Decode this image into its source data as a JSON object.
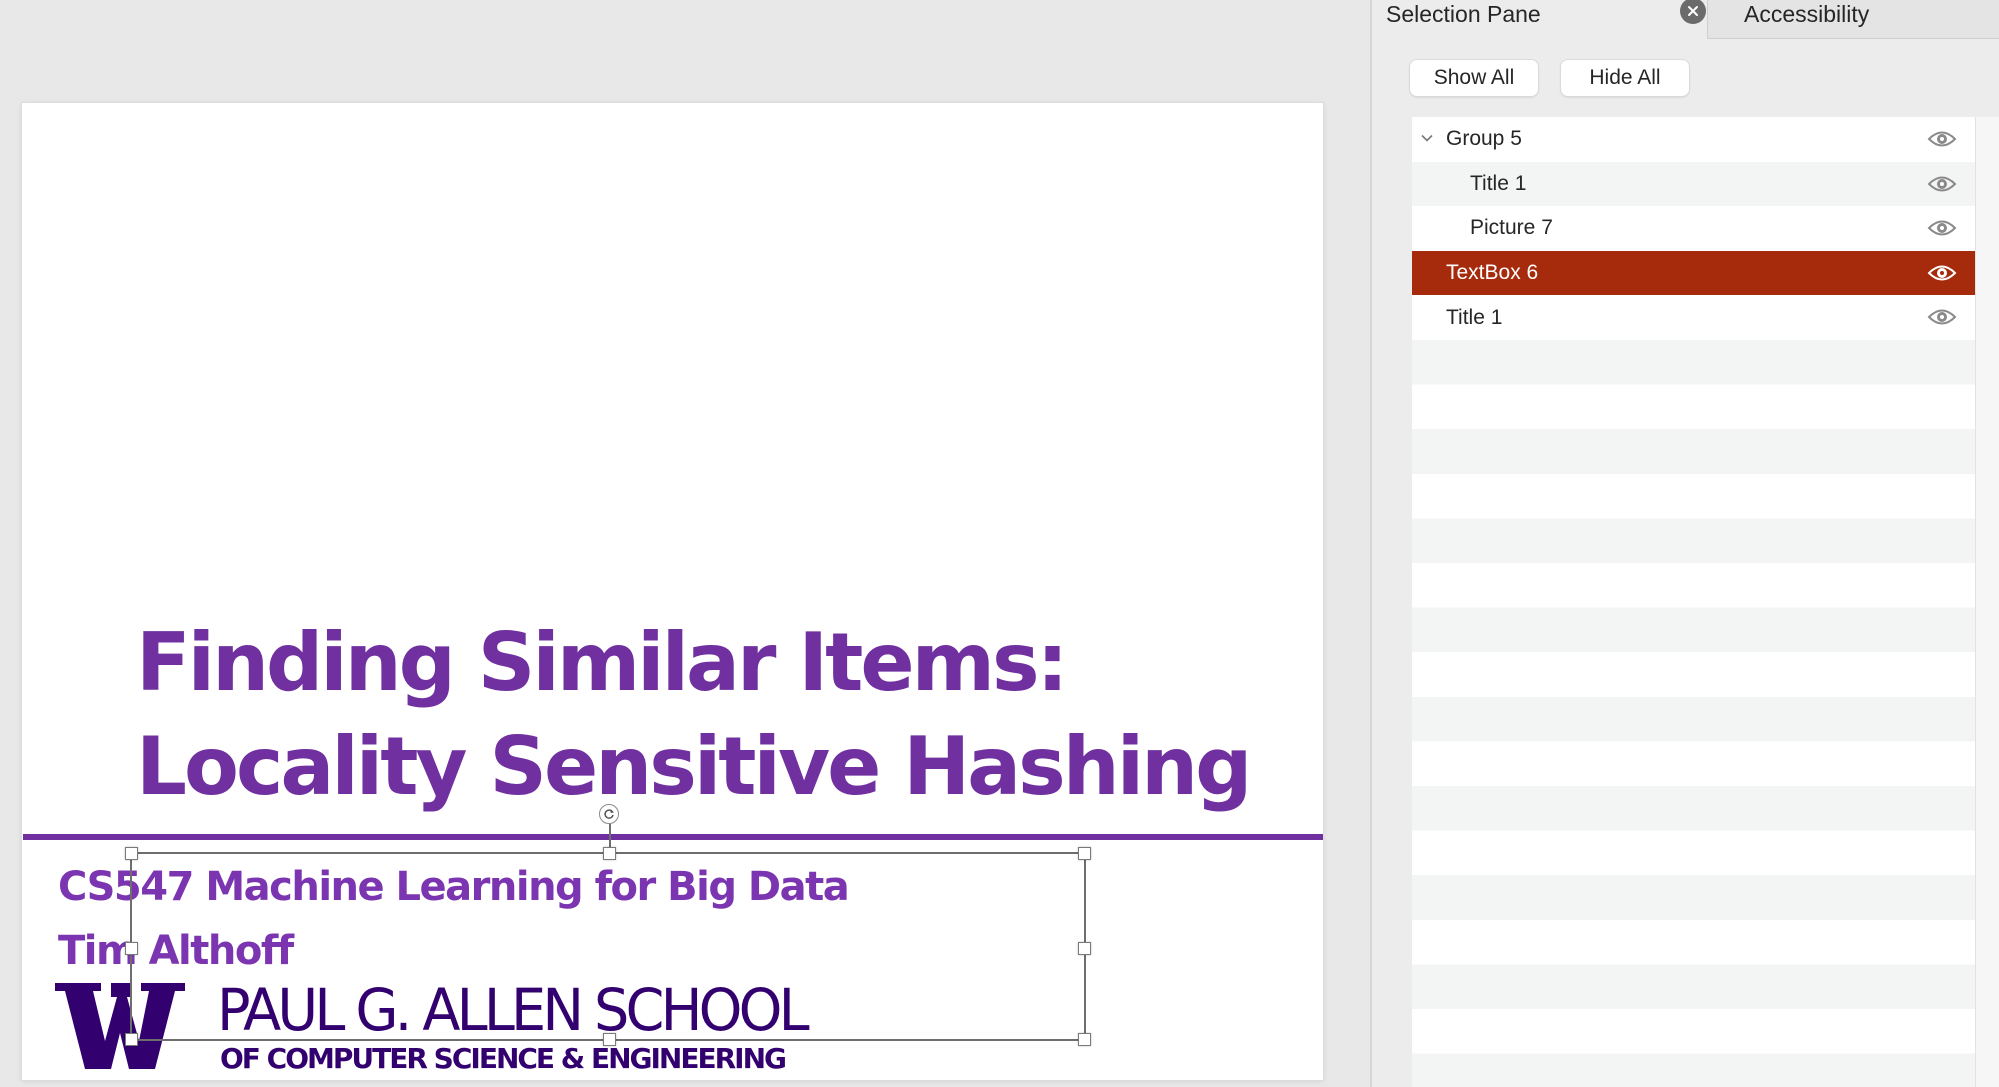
{
  "slide": {
    "title_lines": [
      "Finding Similar Items:",
      "Locality Sensitive Hashing"
    ],
    "subtitle_lines": [
      "CS547 Machine Learning for Big Data",
      "Tim Althoff"
    ],
    "logo": {
      "mark": "W",
      "line1": "PAUL G. ALLEN SCHOOL",
      "line2": "OF COMPUTER SCIENCE & ENGINEERING"
    },
    "selected_object": "TextBox 6"
  },
  "panel": {
    "tabs": [
      {
        "label": "Selection Pane",
        "active": true
      },
      {
        "label": "Accessibility",
        "active": false
      }
    ],
    "close_icon": "close-circle-icon",
    "buttons": {
      "show_all": "Show All",
      "hide_all": "Hide All"
    },
    "items": [
      {
        "label": "Group 5",
        "level": 0,
        "expandable": true,
        "expanded": true,
        "visible": true,
        "selected": false
      },
      {
        "label": "Title 1",
        "level": 1,
        "expandable": false,
        "visible": true,
        "selected": false
      },
      {
        "label": "Picture 7",
        "level": 1,
        "expandable": false,
        "visible": true,
        "selected": false
      },
      {
        "label": "TextBox 6",
        "level": 0,
        "expandable": false,
        "visible": true,
        "selected": true
      },
      {
        "label": "Title 1",
        "level": 0,
        "expandable": false,
        "visible": true,
        "selected": false
      }
    ]
  },
  "colors": {
    "title_purple": "#7030a0",
    "logo_purple": "#33006f",
    "selection_red": "#a62b0d"
  }
}
